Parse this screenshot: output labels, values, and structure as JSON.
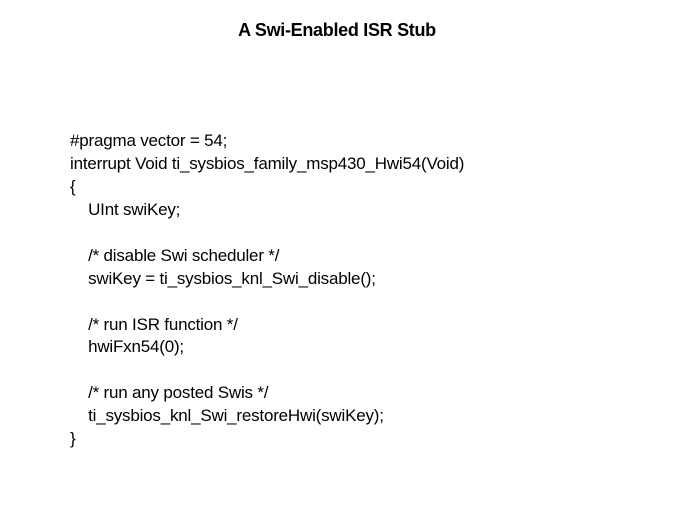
{
  "title": "A Swi-Enabled ISR Stub",
  "code": {
    "line1": "#pragma vector = 54;",
    "line2": "interrupt Void ti_sysbios_family_msp430_Hwi54(Void)",
    "line3": "{",
    "line4": "    UInt swiKey;",
    "line5": "",
    "line6": "    /* disable Swi scheduler */",
    "line7": "    swiKey = ti_sysbios_knl_Swi_disable();",
    "line8": "",
    "line9": "    /* run ISR function */",
    "line10": "    hwiFxn54(0);",
    "line11": "",
    "line12": "    /* run any posted Swis */",
    "line13": "    ti_sysbios_knl_Swi_restoreHwi(swiKey);",
    "line14": "}"
  }
}
